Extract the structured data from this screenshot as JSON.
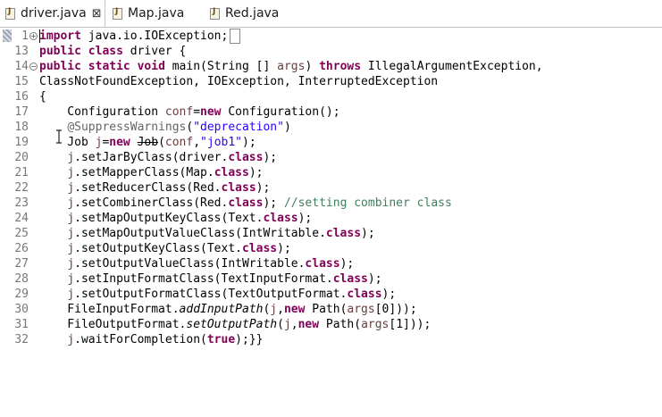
{
  "tabs": [
    {
      "label": "driver.java",
      "close": "⊠",
      "active": true
    },
    {
      "label": "Map.java",
      "active": false
    },
    {
      "label": "Red.java",
      "active": false
    }
  ],
  "lines": [
    {
      "num": "1",
      "text": "import java.io.IOException;"
    },
    {
      "num": "13",
      "text": "public class driver {"
    },
    {
      "num": "14",
      "text": "public static void main(String [] args) throws IllegalArgumentException,"
    },
    {
      "num": "15",
      "text": "ClassNotFoundException, IOException, InterruptedException"
    },
    {
      "num": "16",
      "text": "{"
    },
    {
      "num": "17",
      "text": "    Configuration conf=new Configuration();"
    },
    {
      "num": "18",
      "text": "    @SuppressWarnings(\"deprecation\")"
    },
    {
      "num": "19",
      "text": "    Job j=new Job(conf,\"job1\");"
    },
    {
      "num": "20",
      "text": "    j.setJarByClass(driver.class);"
    },
    {
      "num": "21",
      "text": "    j.setMapperClass(Map.class);"
    },
    {
      "num": "22",
      "text": "    j.setReducerClass(Red.class);"
    },
    {
      "num": "23",
      "text": "    j.setCombinerClass(Red.class); //setting combiner class"
    },
    {
      "num": "24",
      "text": "    j.setMapOutputKeyClass(Text.class);"
    },
    {
      "num": "25",
      "text": "    j.setMapOutputValueClass(IntWritable.class);"
    },
    {
      "num": "26",
      "text": "    j.setOutputKeyClass(Text.class);"
    },
    {
      "num": "27",
      "text": "    j.setOutputValueClass(IntWritable.class);"
    },
    {
      "num": "28",
      "text": "    j.setInputFormatClass(TextInputFormat.class);"
    },
    {
      "num": "29",
      "text": "    j.setOutputFormatClass(TextOutputFormat.class);"
    },
    {
      "num": "30",
      "text": "    FileInputFormat.addInputPath(j,new Path(args[0]));"
    },
    {
      "num": "31",
      "text": "    FileOutputFormat.setOutputPath(j,new Path(args[1]));"
    },
    {
      "num": "32",
      "text": "    j.waitForCompletion(true);}}"
    }
  ],
  "colors": {
    "keyword": "#7f0055",
    "string": "#2a00ff",
    "annotation": "#646464",
    "comment": "#3f7f5f",
    "variable": "#6a3e3e",
    "line_number": "#787878"
  },
  "icons": {
    "java_file": "java-file-icon",
    "close": "close-icon",
    "fold_expand": "fold-expand-icon",
    "fold_collapse": "fold-collapse-icon"
  }
}
